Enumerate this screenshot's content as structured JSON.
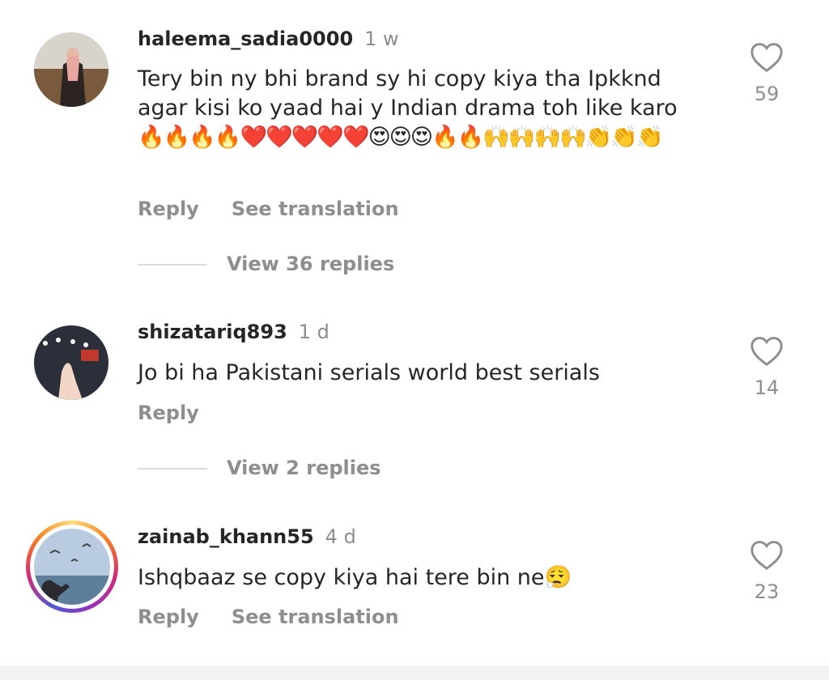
{
  "comments": [
    {
      "username": "haleema_sadia0000",
      "time": "1 w",
      "text": "Tery bin ny bhi brand sy hi copy kiya tha Ipkknd agar kisi ko yaad hai y Indian drama toh like karo",
      "emojis": "🔥🔥🔥🔥❤️❤️❤️❤️❤️😍😍😍🔥🔥🙌🙌🙌🙌👏👏👏",
      "reply_label": "Reply",
      "translate_label": "See translation",
      "view_replies": "View 36 replies",
      "likes": "59"
    },
    {
      "username": "shizatariq893",
      "time": "1 d",
      "text": "Jo bi ha Pakistani serials world best serials",
      "reply_label": "Reply",
      "view_replies": "View 2 replies",
      "likes": "14"
    },
    {
      "username": "zainab_khann55",
      "time": "4 d",
      "text": "Ishqbaaz se copy kiya hai tere bin ne😮‍💨",
      "reply_label": "Reply",
      "translate_label": "See translation",
      "likes": "23"
    }
  ],
  "icons": {
    "like": "heart-outline-icon"
  },
  "colors": {
    "primary_text": "#262626",
    "secondary_text": "#8e8e8e",
    "story_ring": "#d62976"
  }
}
